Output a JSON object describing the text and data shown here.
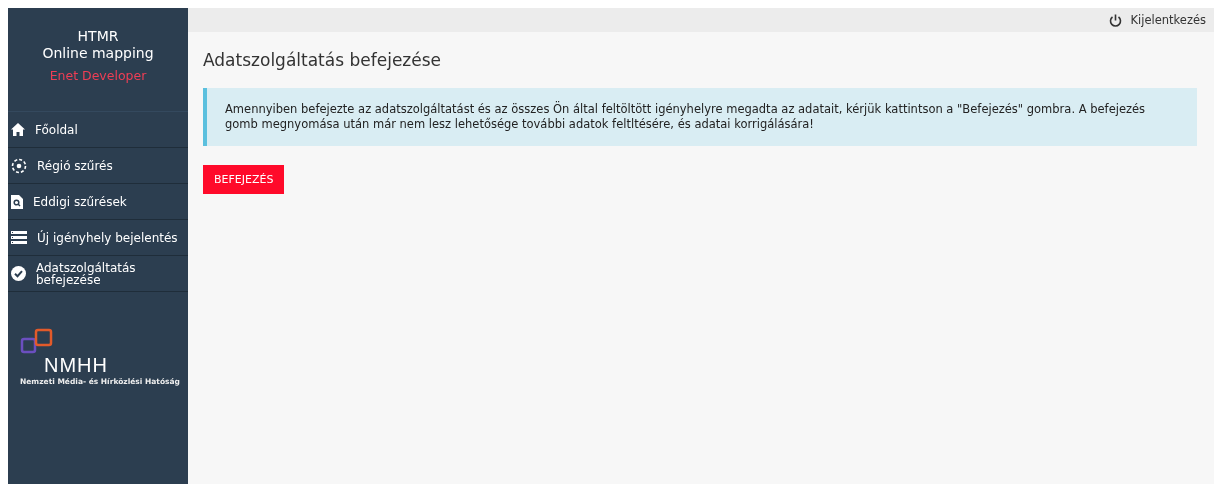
{
  "sidebar": {
    "title": "HTMR",
    "subtitle": "Online mapping",
    "user": "Enet Developer",
    "items": [
      {
        "label": "Főoldal",
        "kind": "home"
      },
      {
        "label": "Régió szűrés",
        "kind": "region"
      },
      {
        "label": "Eddigi szűrések",
        "kind": "search-doc"
      },
      {
        "label": "Új igényhely bejelentés",
        "kind": "list"
      },
      {
        "label": "Adatszolgáltatás befejezése",
        "kind": "check"
      }
    ],
    "logo": {
      "mark": "NMHH",
      "caption": "Nemzeti Média- és Hírközlési Hatóság"
    }
  },
  "topbar": {
    "logout": "Kijelentkezés"
  },
  "page": {
    "title": "Adatszolgáltatás befejezése",
    "notice": "Amennyiben befejezte az adatszolgáltatást és az összes Ön által feltöltött igényhelyre megadta az adatait, kérjük kattintson a \"Befejezés\" gombra. A befejezés gomb megnyomása után már nem lesz lehetősége további adatok feltltésére, és adatai korrigálására!",
    "button": "BEFEJEZÉS"
  }
}
